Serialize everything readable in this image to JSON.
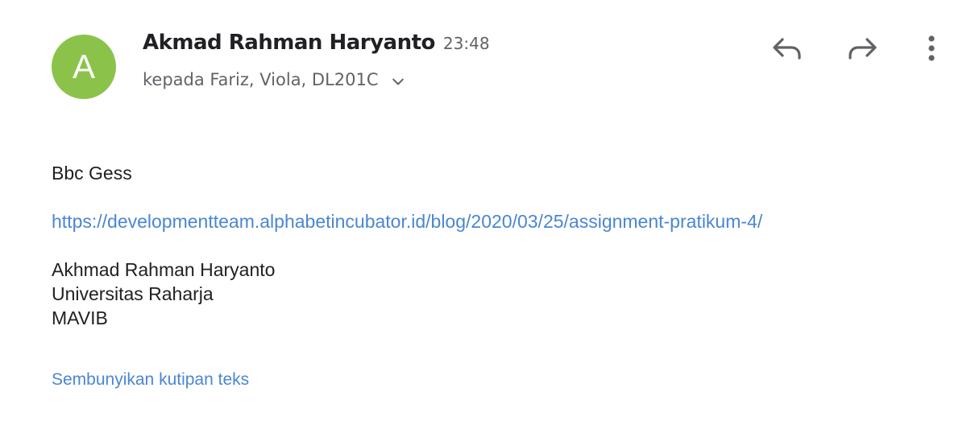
{
  "sender": {
    "avatar_initial": "A",
    "avatar_color": "#8bc34a",
    "name": "Akmad Rahman Haryanto",
    "time": "23:48"
  },
  "recipients": {
    "text": "kepada Fariz, Viola, DL201C",
    "expand_icon": "chevron-down-icon"
  },
  "actions": {
    "reply_icon": "reply-icon",
    "forward_icon": "forward-icon",
    "more_icon": "more-vert-icon"
  },
  "message": {
    "greeting": "Bbc Gess",
    "link": "https://developmentteam.alphabetincubator.id/blog/2020/03/25/assignment-pratikum-4/",
    "signature": [
      "Akhmad Rahman Haryanto",
      "Universitas Raharja",
      "MAVIB"
    ]
  },
  "footer": {
    "hide_quoted_label": "Sembunyikan kutipan teks"
  },
  "colors": {
    "link": "#4a86d4",
    "secondary_text": "#5f6368",
    "icon": "#5f6368"
  }
}
